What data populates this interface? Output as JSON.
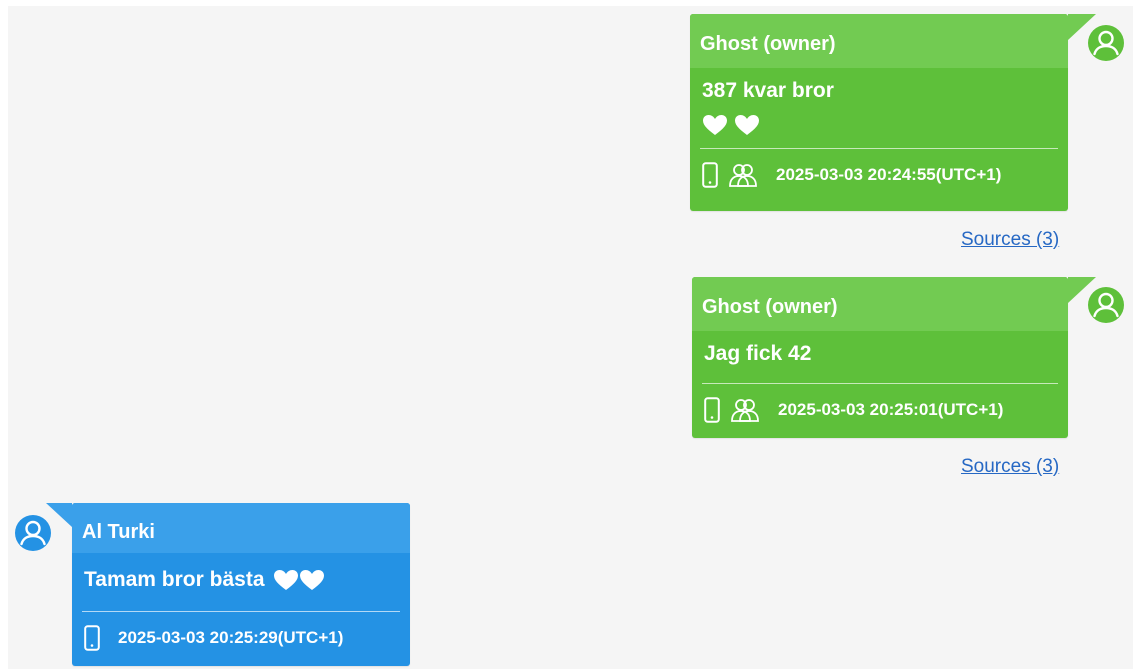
{
  "colors": {
    "outgoing_bg": "#5ec03a",
    "outgoing_header": "#72cb52",
    "incoming_bg": "#2492e4",
    "incoming_header": "#3aa0ea",
    "link": "#2668c4",
    "canvas_bg": "#f5f5f5"
  },
  "messages": [
    {
      "direction": "outgoing",
      "sender": "Ghost (owner)",
      "text": "387 kvar bror",
      "emoji": [
        "white-heart",
        "white-heart"
      ],
      "icons": [
        "phone-icon",
        "group-icon"
      ],
      "timestamp": "2025-03-03 20:24:55(UTC+1)",
      "sources_label": "Sources (3)"
    },
    {
      "direction": "outgoing",
      "sender": "Ghost (owner)",
      "text": "Jag fick 42",
      "icons": [
        "phone-icon",
        "group-icon"
      ],
      "timestamp": "2025-03-03 20:25:01(UTC+1)",
      "sources_label": "Sources (3)"
    },
    {
      "direction": "incoming",
      "sender": "Al Turki",
      "text": "Tamam bror bästa",
      "emoji": [
        "white-heart",
        "white-heart"
      ],
      "icons": [
        "phone-icon"
      ],
      "timestamp": "2025-03-03 20:25:29(UTC+1)"
    }
  ]
}
